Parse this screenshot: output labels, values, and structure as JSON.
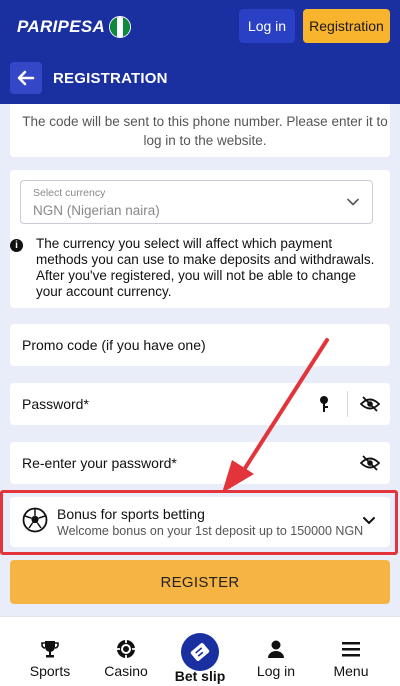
{
  "header": {
    "logo_text": "PARIPESA",
    "login_label": "Log in",
    "registration_label": "Registration",
    "flag_colors": [
      "#0f8a3c",
      "#ffffff",
      "#0f8a3c"
    ]
  },
  "subheader": {
    "title": "REGISTRATION"
  },
  "form": {
    "phone_hint": "The code will be sent to this phone number. Please enter it to log in to the website.",
    "currency": {
      "label": "Select currency",
      "value": "NGN  (Nigerian naira)"
    },
    "currency_info": "The currency you select will affect which payment methods you can use to make deposits and withdrawals. After you've registered, you will not be able to change your account currency.",
    "promo_placeholder": "Promo code (if you have one)",
    "password_placeholder": "Password*",
    "reenter_placeholder": "Re-enter your password*",
    "bonus": {
      "title": "Bonus for sports betting",
      "subtitle": "Welcome bonus on your 1st deposit up to 150000 NGN"
    },
    "register_label": "REGISTER"
  },
  "bottom_nav": {
    "sports": "Sports",
    "casino": "Casino",
    "betslip": "Bet slip",
    "login": "Log in",
    "menu": "Menu"
  },
  "colors": {
    "brand_blue": "#1a2fa0",
    "accent_orange": "#f7b42c",
    "highlight_red": "#e2343a"
  }
}
